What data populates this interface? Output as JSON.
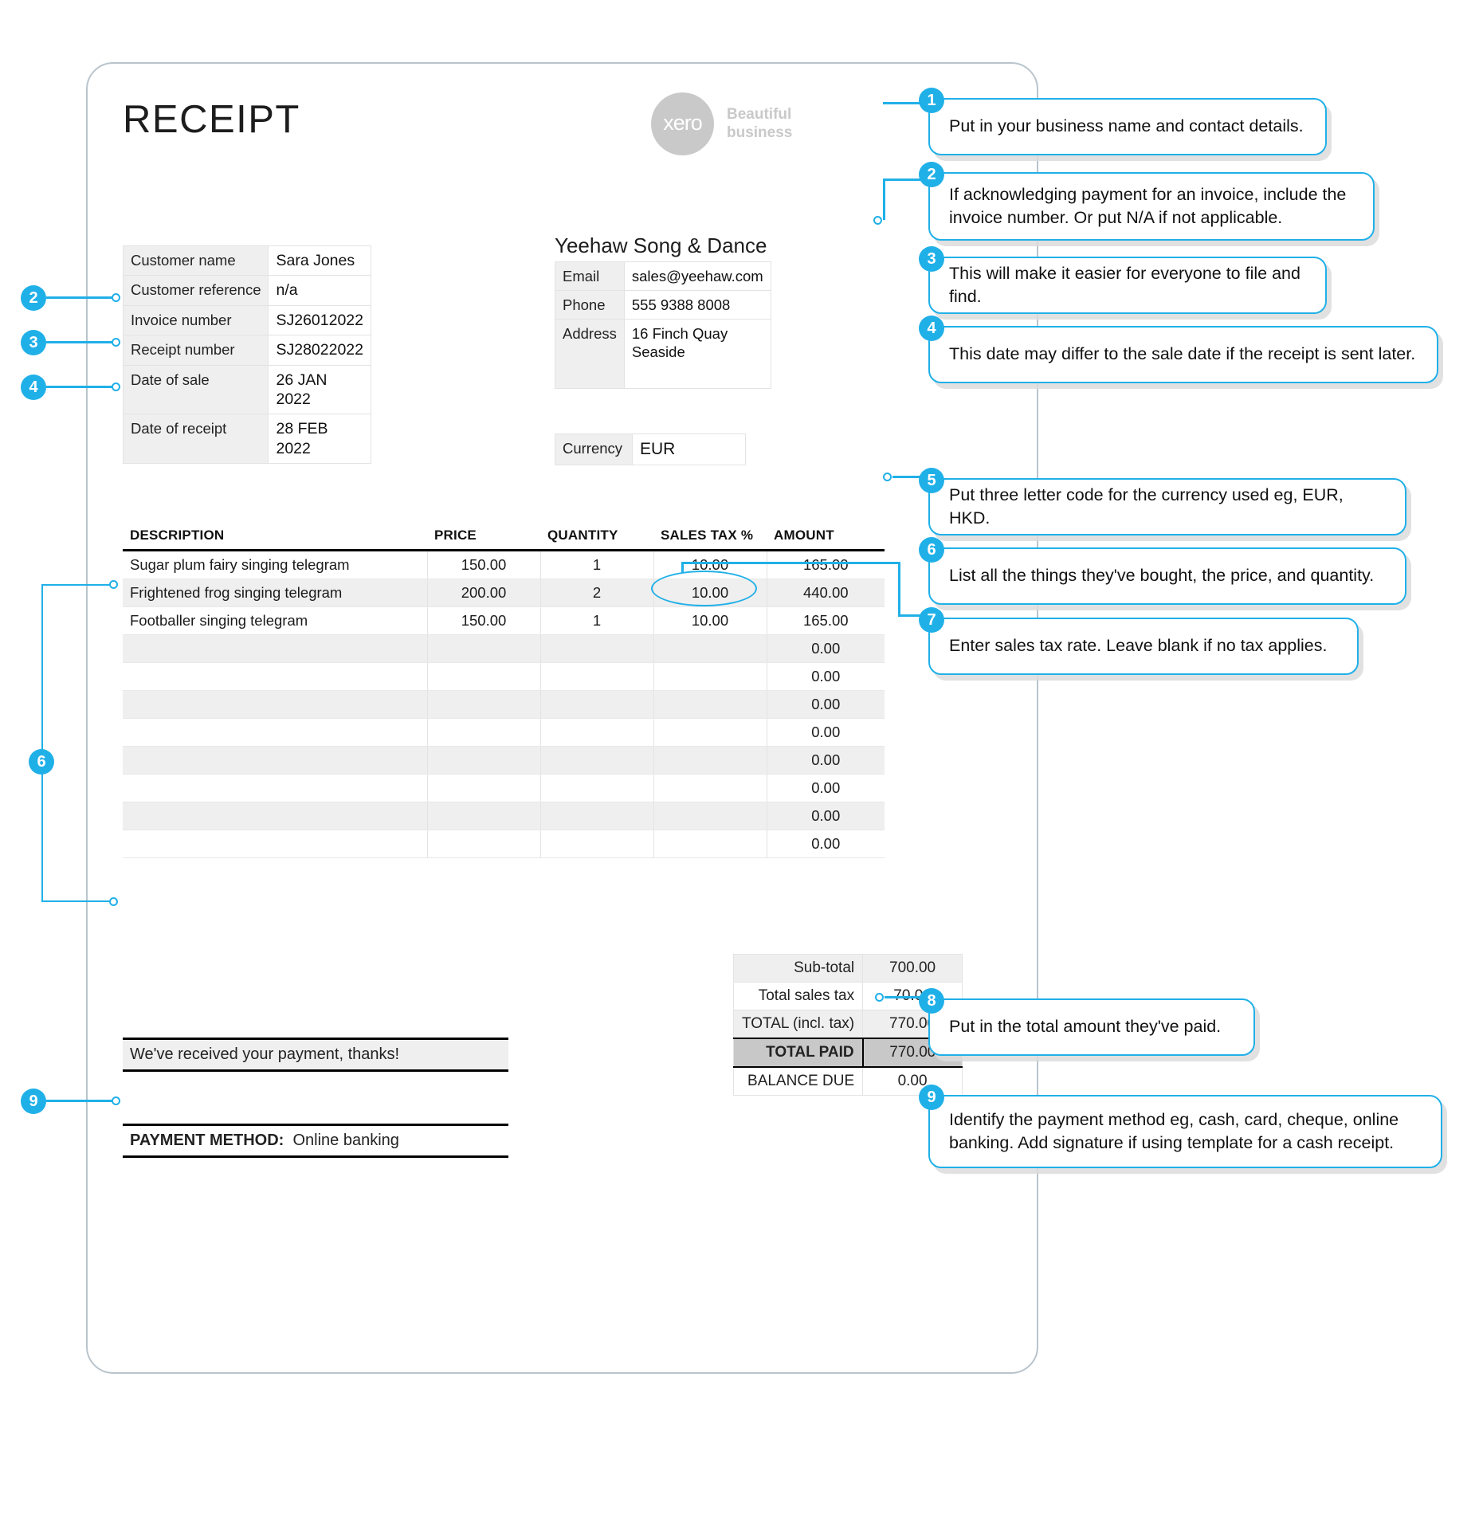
{
  "document": {
    "title": "RECEIPT"
  },
  "brand": {
    "logo_text": "xero",
    "tagline_line1": "Beautiful",
    "tagline_line2": "business",
    "accent_color": "#20b0e8",
    "logo_color": "#c9c9c9"
  },
  "customer_details": {
    "rows": [
      {
        "label": "Customer name",
        "value": "Sara Jones"
      },
      {
        "label": "Customer reference",
        "value": "n/a"
      },
      {
        "label": "Invoice number",
        "value": "SJ26012022"
      },
      {
        "label": "Receipt number",
        "value": "SJ28022022"
      },
      {
        "label": "Date of sale",
        "value": "26 JAN 2022"
      },
      {
        "label": "Date of receipt",
        "value": "28 FEB 2022"
      }
    ]
  },
  "business": {
    "name": "Yeehaw Song & Dance",
    "email_label": "Email",
    "email_value": "sales@yeehaw.com",
    "phone_label": "Phone",
    "phone_value": "555 9388 8008",
    "address_label": "Address",
    "address_value": "16 Finch Quay\nSeaside"
  },
  "currency": {
    "label": "Currency",
    "value": "EUR"
  },
  "line_items": {
    "headers": [
      "DESCRIPTION",
      "PRICE",
      "QUANTITY",
      "SALES TAX %",
      "AMOUNT"
    ],
    "rows": [
      {
        "description": "Sugar plum fairy singing telegram",
        "price": "150.00",
        "quantity": "1",
        "sales_tax": "10.00",
        "amount": "165.00"
      },
      {
        "description": "Frightened frog singing telegram",
        "price": "200.00",
        "quantity": "2",
        "sales_tax": "10.00",
        "amount": "440.00"
      },
      {
        "description": "Footballer singing telegram",
        "price": "150.00",
        "quantity": "1",
        "sales_tax": "10.00",
        "amount": "165.00"
      },
      {
        "description": "",
        "price": "",
        "quantity": "",
        "sales_tax": "",
        "amount": "0.00"
      },
      {
        "description": "",
        "price": "",
        "quantity": "",
        "sales_tax": "",
        "amount": "0.00"
      },
      {
        "description": "",
        "price": "",
        "quantity": "",
        "sales_tax": "",
        "amount": "0.00"
      },
      {
        "description": "",
        "price": "",
        "quantity": "",
        "sales_tax": "",
        "amount": "0.00"
      },
      {
        "description": "",
        "price": "",
        "quantity": "",
        "sales_tax": "",
        "amount": "0.00"
      },
      {
        "description": "",
        "price": "",
        "quantity": "",
        "sales_tax": "",
        "amount": "0.00"
      },
      {
        "description": "",
        "price": "",
        "quantity": "",
        "sales_tax": "",
        "amount": "0.00"
      },
      {
        "description": "",
        "price": "",
        "quantity": "",
        "sales_tax": "",
        "amount": "0.00"
      }
    ]
  },
  "totals": {
    "rows": [
      {
        "label": "Sub-total",
        "value": "700.00"
      },
      {
        "label": "Total sales tax",
        "value": "70.00"
      },
      {
        "label": "TOTAL (incl. tax)",
        "value": "770.00"
      },
      {
        "label": "TOTAL PAID",
        "value": "770.00"
      },
      {
        "label": "BALANCE DUE",
        "value": "0.00"
      }
    ]
  },
  "footer": {
    "message": "We've received your payment, thanks!",
    "payment_method_label": "PAYMENT METHOD:",
    "payment_method_value": "Online banking"
  },
  "annotations": [
    {
      "number": "1",
      "text": "Put in your business name and contact details."
    },
    {
      "number": "2",
      "text": "If acknowledging payment for an invoice, include the invoice number. Or put N/A if not applicable."
    },
    {
      "number": "3",
      "text": "This will make it easier for everyone to file and find."
    },
    {
      "number": "4",
      "text": "This date may differ to the sale date if the receipt is sent later."
    },
    {
      "number": "5",
      "text": "Put three letter code for the currency used eg, EUR, HKD."
    },
    {
      "number": "6",
      "text": "List all the things they've bought, the price, and quantity."
    },
    {
      "number": "7",
      "text": "Enter sales tax rate. Leave blank if no tax applies."
    },
    {
      "number": "8",
      "text": "Put in the total amount they've paid."
    },
    {
      "number": "9",
      "text": "Identify the payment method eg, cash, card, cheque, online banking. Add signature if using template for a cash receipt."
    }
  ],
  "left_markers": [
    {
      "number": "2"
    },
    {
      "number": "3"
    },
    {
      "number": "4"
    },
    {
      "number": "6"
    },
    {
      "number": "9"
    }
  ]
}
